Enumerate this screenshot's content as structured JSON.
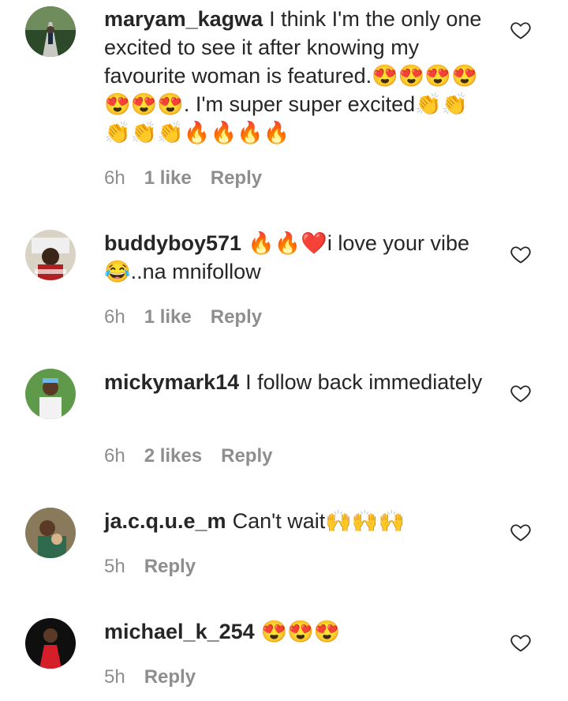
{
  "comments": [
    {
      "username": "maryam_kagwa",
      "text": "I think I'm the only one excited to see it after knowing my favourite woman is featured.😍😍😍😍😍😍😍. I'm super super excited👏👏👏👏👏🔥🔥🔥🔥",
      "time": "6h",
      "likes": "1 like",
      "reply": "Reply",
      "avatar_icon": "avatar-photo"
    },
    {
      "username": "buddyboy571",
      "text": "🔥🔥❤️i love your vibe 😂..na mnifollow",
      "time": "6h",
      "likes": "1 like",
      "reply": "Reply",
      "avatar_icon": "avatar-photo"
    },
    {
      "username": "mickymark14",
      "text": "I follow back immediately",
      "time": "6h",
      "likes": "2 likes",
      "reply": "Reply",
      "avatar_icon": "avatar-photo"
    },
    {
      "username": "ja.c.q.u.e_m",
      "text": "Can't wait🙌🙌🙌",
      "time": "5h",
      "likes": "",
      "reply": "Reply",
      "avatar_icon": "avatar-photo"
    },
    {
      "username": "michael_k_254",
      "text": "😍😍😍",
      "time": "5h",
      "likes": "",
      "reply": "Reply",
      "avatar_icon": "avatar-photo"
    }
  ]
}
